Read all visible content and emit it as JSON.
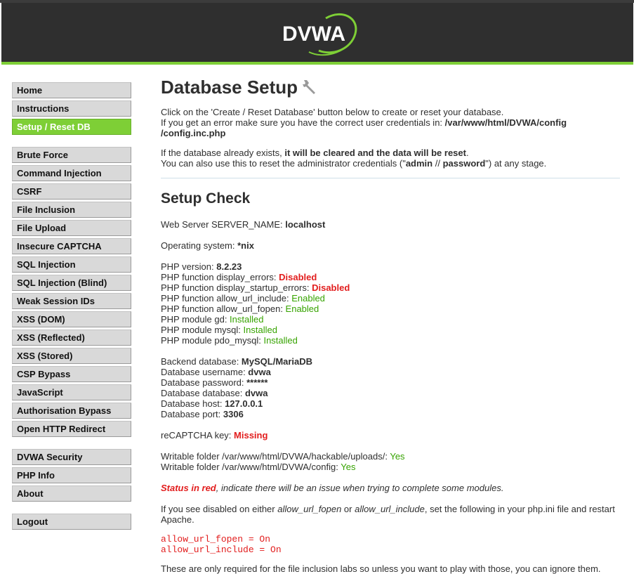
{
  "header": {
    "logo_text": "DVWA"
  },
  "sidebar": {
    "groups": [
      [
        {
          "label": "Home"
        },
        {
          "label": "Instructions"
        },
        {
          "label": "Setup / Reset DB",
          "selected": true
        }
      ],
      [
        {
          "label": "Brute Force"
        },
        {
          "label": "Command Injection"
        },
        {
          "label": "CSRF"
        },
        {
          "label": "File Inclusion"
        },
        {
          "label": "File Upload"
        },
        {
          "label": "Insecure CAPTCHA"
        },
        {
          "label": "SQL Injection"
        },
        {
          "label": "SQL Injection (Blind)"
        },
        {
          "label": "Weak Session IDs"
        },
        {
          "label": "XSS (DOM)"
        },
        {
          "label": "XSS (Reflected)"
        },
        {
          "label": "XSS (Stored)"
        },
        {
          "label": "CSP Bypass"
        },
        {
          "label": "JavaScript"
        },
        {
          "label": "Authorisation Bypass"
        },
        {
          "label": "Open HTTP Redirect"
        }
      ],
      [
        {
          "label": "DVWA Security"
        },
        {
          "label": "PHP Info"
        },
        {
          "label": "About"
        }
      ],
      [
        {
          "label": "Logout"
        }
      ]
    ]
  },
  "main": {
    "title": "Database Setup",
    "intro1": "Click on the 'Create / Reset Database' button below to create or reset your database.",
    "intro2_prefix": "If you get an error make sure you have the correct user credentials in: ",
    "intro2_path_line1": "/var/www/html/DVWA/config",
    "intro2_path_line2": "/config.inc.php",
    "intro3_prefix": "If the database already exists, ",
    "intro3_bold": "it will be cleared and the data will be reset",
    "intro3_suffix": ".",
    "intro4_prefix": "You can also use this to reset the administrator credentials (\"",
    "intro4_user": "admin",
    "intro4_sep": " // ",
    "intro4_pass": "password",
    "intro4_suffix": "\") at any stage.",
    "setup_check_title": "Setup Check",
    "server_name_label": "Web Server SERVER_NAME: ",
    "server_name_value": "localhost",
    "os_label": "Operating system: ",
    "os_value": "*nix",
    "php_version_label": "PHP version: ",
    "php_version_value": "8.2.23",
    "display_errors_label": "PHP function display_errors: ",
    "display_errors_value": "Disabled",
    "display_startup_errors_label": "PHP function display_startup_errors: ",
    "display_startup_errors_value": "Disabled",
    "allow_url_include_label": "PHP function allow_url_include: ",
    "allow_url_include_value": "Enabled",
    "allow_url_fopen_label": "PHP function allow_url_fopen: ",
    "allow_url_fopen_value": "Enabled",
    "gd_label": "PHP module gd: ",
    "gd_value": "Installed",
    "mysql_label": "PHP module mysql: ",
    "mysql_value": "Installed",
    "pdo_label": "PHP module pdo_mysql: ",
    "pdo_value": "Installed",
    "backend_label": "Backend database: ",
    "backend_value": "MySQL/MariaDB",
    "db_user_label": "Database username: ",
    "db_user_value": "dvwa",
    "db_pass_label": "Database password: ",
    "db_pass_value": "******",
    "db_name_label": "Database database: ",
    "db_name_value": "dvwa",
    "db_host_label": "Database host: ",
    "db_host_value": "127.0.0.1",
    "db_port_label": "Database port: ",
    "db_port_value": "3306",
    "recaptcha_label": "reCAPTCHA key: ",
    "recaptcha_value": "Missing",
    "uploads_label": "Writable folder /var/www/html/DVWA/hackable/uploads/: ",
    "uploads_value": "Yes",
    "config_label": "Writable folder /var/www/html/DVWA/config: ",
    "config_value": "Yes",
    "status_red": "Status in red",
    "status_rest": ", indicate there will be an issue when trying to complete some modules.",
    "disabled_prefix": "If you see disabled on either ",
    "disabled_fopen": "allow_url_fopen",
    "disabled_or": " or ",
    "disabled_include": "allow_url_include",
    "disabled_suffix": ", set the following in your php.ini file and restart Apache.",
    "code_line1": "allow_url_fopen = On",
    "code_line2": "allow_url_include = On",
    "footer_note": "These are only required for the file inclusion labs so unless you want to play with those, you can ignore them."
  },
  "colors": {
    "accent": "#7ecf36",
    "header_bg": "#2f2f2f",
    "error": "#e21d1d",
    "ok": "#36a300"
  }
}
